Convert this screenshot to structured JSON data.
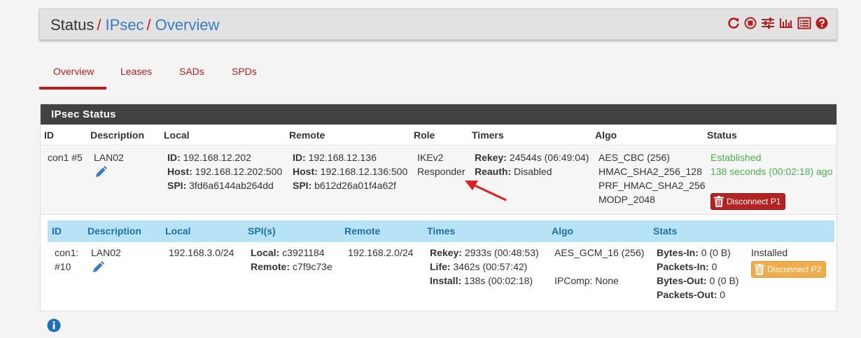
{
  "breadcrumb": {
    "root": "Status",
    "section": "IPsec",
    "page": "Overview"
  },
  "header_icons": [
    "reload-icon",
    "stop-icon",
    "settings-icon",
    "chart-icon",
    "log-icon",
    "help-icon"
  ],
  "tabs": [
    {
      "label": "Overview",
      "active": true
    },
    {
      "label": "Leases",
      "active": false
    },
    {
      "label": "SADs",
      "active": false
    },
    {
      "label": "SPDs",
      "active": false
    }
  ],
  "panel": {
    "title": "IPsec Status",
    "columns": [
      "ID",
      "Description",
      "Local",
      "Remote",
      "Role",
      "Timers",
      "Algo",
      "Status"
    ],
    "phase1": {
      "id": "con1 #5",
      "description": "LAN02",
      "local": {
        "id_label": "ID:",
        "id": "192.168.12.202",
        "host_label": "Host:",
        "host": "192.168.12.202:500",
        "spi_label": "SPI:",
        "spi": "3fd6a6144ab264dd"
      },
      "remote": {
        "id_label": "ID:",
        "id": "192.168.12.136",
        "host_label": "Host:",
        "host": "192.168.12.136:500",
        "spi_label": "SPI:",
        "spi": "b612d26a01f4a62f"
      },
      "role": [
        "IKEv2",
        "Responder"
      ],
      "timers": {
        "rekey_label": "Rekey:",
        "rekey": "24544s (06:49:04)",
        "reauth_label": "Reauth:",
        "reauth": "Disabled"
      },
      "algo": [
        "AES_CBC (256)",
        "HMAC_SHA2_256_128",
        "PRF_HMAC_SHA2_256",
        "MODP_2048"
      ],
      "status": {
        "state": "Established",
        "uptime": "138 seconds (00:02:18) ago",
        "button": "Disconnect P1"
      }
    },
    "phase2_columns": [
      "ID",
      "Description",
      "Local",
      "SPI(s)",
      "Remote",
      "Times",
      "Algo",
      "Stats"
    ],
    "phase2": {
      "id_line1": "con1:",
      "id_line2": "#10",
      "description": "LAN02",
      "local": "192.168.3.0/24",
      "spis": {
        "local_label": "Local:",
        "local": "c3921184",
        "remote_label": "Remote:",
        "remote": "c7f9c73e"
      },
      "remote": "192.168.2.0/24",
      "times": {
        "rekey_label": "Rekey:",
        "rekey": "2933s (00:48:53)",
        "life_label": "Life:",
        "life": "3462s (00:57:42)",
        "install_label": "Install:",
        "install": "138s (00:02:18)"
      },
      "algo": {
        "cipher": "AES_GCM_16 (256)",
        "ipcomp": "IPComp: None"
      },
      "stats": {
        "bytes_in_label": "Bytes-In:",
        "bytes_in": "0 (0 B)",
        "packets_in_label": "Packets-In:",
        "packets_in": "0",
        "bytes_out_label": "Bytes-Out:",
        "bytes_out": "0 (0 B)",
        "packets_out_label": "Packets-Out:",
        "packets_out": "0"
      },
      "state": "Installed",
      "button": "Disconnect P2"
    }
  },
  "colors": {
    "accent": "#b31e1e",
    "link": "#3a7bbf",
    "success": "#4cae4c",
    "panel_header": "#424242",
    "subheader": "#b8e3f7",
    "warning": "#f0ad4e"
  }
}
